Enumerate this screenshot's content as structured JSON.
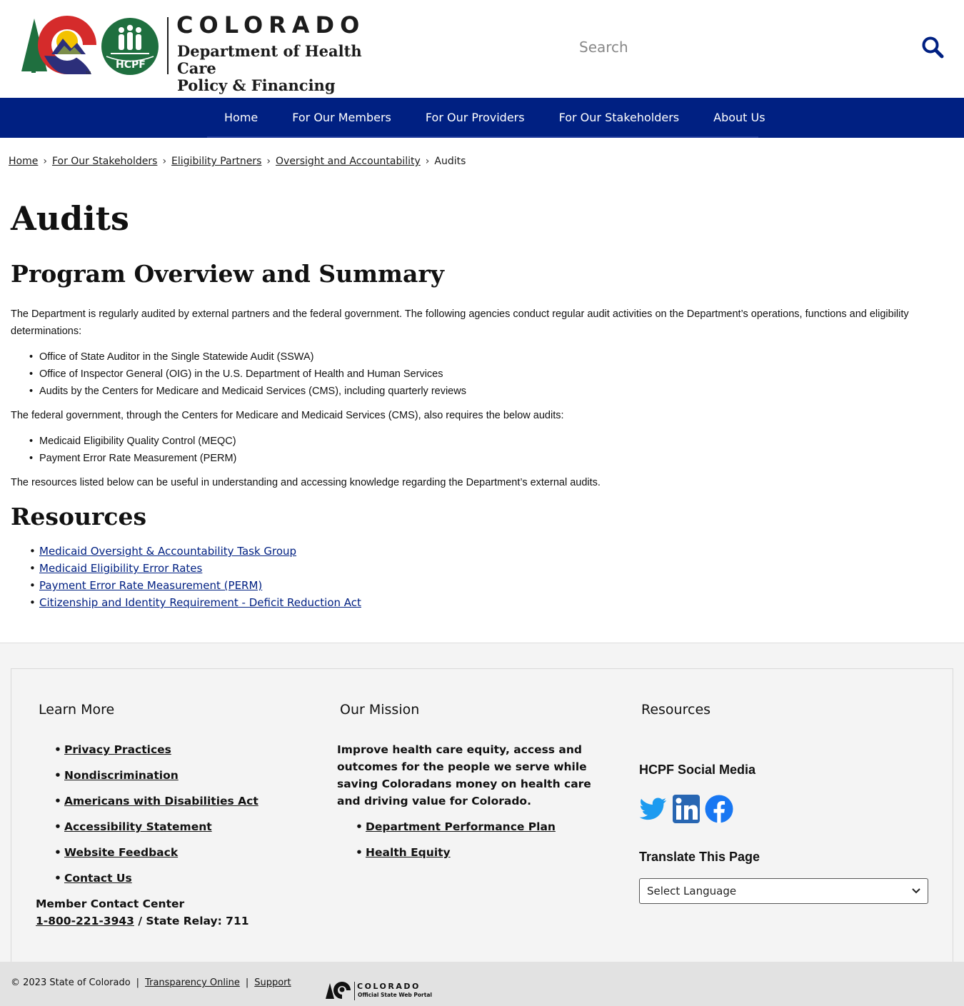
{
  "header": {
    "state_name": "COLORADO",
    "department_line1": "Department of Health Care",
    "department_line2": "Policy & Financing",
    "hcpf_badge": "HCPF",
    "search": {
      "placeholder": "Search",
      "icon": "search-icon"
    }
  },
  "nav": {
    "items": [
      {
        "label": "Home"
      },
      {
        "label": "For Our Members"
      },
      {
        "label": "For Our Providers"
      },
      {
        "label": "For Our Stakeholders"
      },
      {
        "label": "About Us"
      }
    ]
  },
  "breadcrumb": {
    "items": [
      {
        "label": "Home"
      },
      {
        "label": "For Our Stakeholders"
      },
      {
        "label": "Eligibility Partners"
      },
      {
        "label": "Oversight and Accountability"
      }
    ],
    "current": "Audits",
    "separator": "›"
  },
  "main": {
    "title": "Audits",
    "overview_heading": "Program Overview and Summary",
    "intro": "The Department is regularly audited by external partners and the federal government.  The following agencies conduct regular audit activities on the Department’s operations, functions and eligibility determinations:",
    "agencies": [
      "Office of State Auditor in the Single Statewide Audit (SSWA)",
      "Office of Inspector General (OIG) in the U.S. Department of Health and Human Services",
      "Audits by the Centers for Medicare and Medicaid Services (CMS), including quarterly reviews"
    ],
    "federal_text": "The federal government, through the Centers for Medicare and Medicaid Services (CMS), also requires the below audits:",
    "federal_audits": [
      "Medicaid Eligibility Quality Control (MEQC)",
      "Payment Error Rate Measurement (PERM)"
    ],
    "resources_text": "The resources listed below can be useful in understanding and accessing knowledge regarding the Department’s external audits.",
    "resources_heading": "Resources",
    "resource_links": [
      "Medicaid Oversight & Accountability Task Group",
      "Medicaid Eligibility Error Rates",
      "Payment Error Rate Measurement (PERM)",
      "Citizenship and Identity Requirement - Deficit Reduction Act"
    ]
  },
  "footer": {
    "learn_more": {
      "title": "Learn More",
      "links": [
        "Privacy Practices",
        "Nondiscrimination",
        "Americans with Disabilities Act",
        "Accessibility Statement",
        "Website Feedback",
        "Contact Us"
      ],
      "contact_label": "Member Contact Center",
      "phone": "1-800-221-3943",
      "relay": " / State Relay: 711"
    },
    "mission": {
      "title": "Our Mission",
      "text": "Improve health care equity, access and outcomes for the people we serve while saving Coloradans money on health care and driving value for Colorado.",
      "links": [
        "Department Performance Plan",
        "Health Equity"
      ]
    },
    "resources": {
      "title": "Resources",
      "social_title": "HCPF Social Media",
      "social_icons": [
        "twitter-icon",
        "linkedin-icon",
        "facebook-icon"
      ],
      "translate_title": "Translate This Page",
      "language_selected": "Select Language"
    }
  },
  "bottom_bar": {
    "copyright": "© 2023 State of Colorado",
    "links": [
      "Transparency Online",
      "Support"
    ],
    "portal_name": "COLORADO",
    "portal_sub": "Official State Web Portal"
  },
  "colors": {
    "nav_blue": "#002082",
    "link_blue": "#002082",
    "hcpf_green": "#1f6f3f",
    "twitter_blue": "#1d9bf0",
    "linkedin_blue": "#2866b2",
    "facebook_blue": "#1877f2",
    "footer_bg": "#f4f4f4",
    "bottom_bar_bg": "#e2e2e2"
  }
}
